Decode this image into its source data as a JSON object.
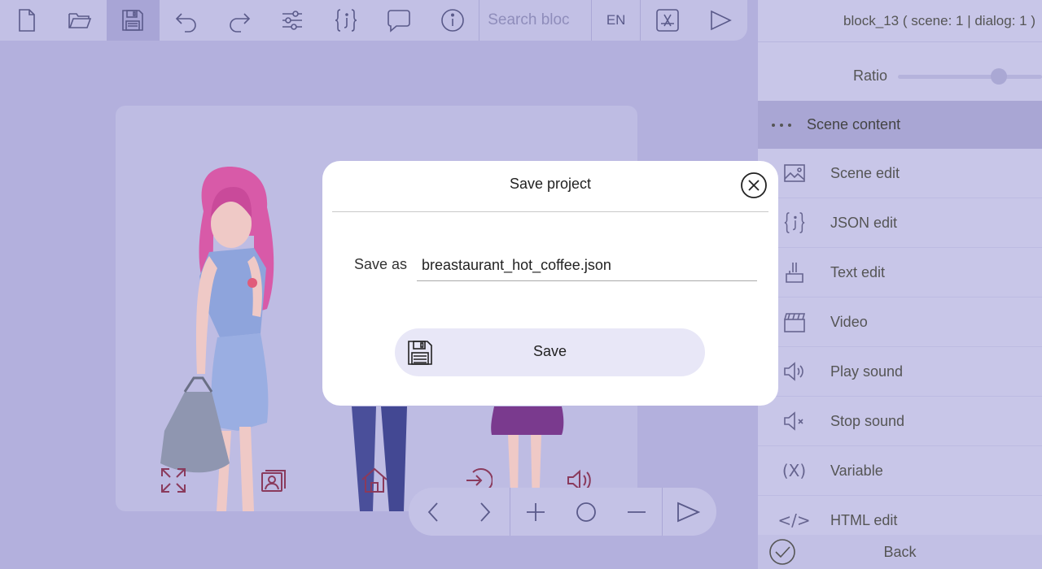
{
  "toolbar": {
    "buttons": [
      {
        "name": "new-file",
        "icon": "new-file-icon"
      },
      {
        "name": "open-folder",
        "icon": "folder-open-icon"
      },
      {
        "name": "save",
        "icon": "floppy-disk-icon",
        "active": true
      },
      {
        "name": "undo",
        "icon": "undo-icon"
      },
      {
        "name": "redo",
        "icon": "redo-icon"
      },
      {
        "name": "settings",
        "icon": "sliders-icon"
      },
      {
        "name": "json",
        "icon": "json-braces-icon"
      },
      {
        "name": "comment",
        "icon": "speech-bubble-icon"
      },
      {
        "name": "info",
        "icon": "info-icon"
      }
    ],
    "search_placeholder": "Search bloc",
    "language": "EN"
  },
  "panel": {
    "header": "block_13 ( scene: 1 | dialog: 1 )",
    "ratio_label": "Ratio",
    "section_title": "Scene content",
    "items": [
      {
        "label": "Scene edit",
        "icon": "image-icon"
      },
      {
        "label": "JSON edit",
        "icon": "json-braces-icon"
      },
      {
        "label": "Text edit",
        "icon": "text-cursor-icon"
      },
      {
        "label": "Video",
        "icon": "clapperboard-icon"
      },
      {
        "label": "Play sound",
        "icon": "speaker-icon"
      },
      {
        "label": "Stop sound",
        "icon": "speaker-mute-icon"
      },
      {
        "label": "Variable",
        "icon": "variable-icon",
        "glyph": "(X)"
      },
      {
        "label": "HTML edit",
        "icon": "code-icon",
        "glyph": "</>"
      }
    ],
    "back_label": "Back"
  },
  "modal": {
    "title": "Save project",
    "save_as_label": "Save as",
    "filename": "breastaurant_hot_coffee.json",
    "save_button": "Save"
  },
  "colors": {
    "background": "#b3b0dd",
    "toolbar": "#c2c0e5",
    "panel": "#c8c6e8",
    "section": "#a9a6d4",
    "modal": "#ffffff",
    "stage_icon": "#8a3a5c"
  }
}
